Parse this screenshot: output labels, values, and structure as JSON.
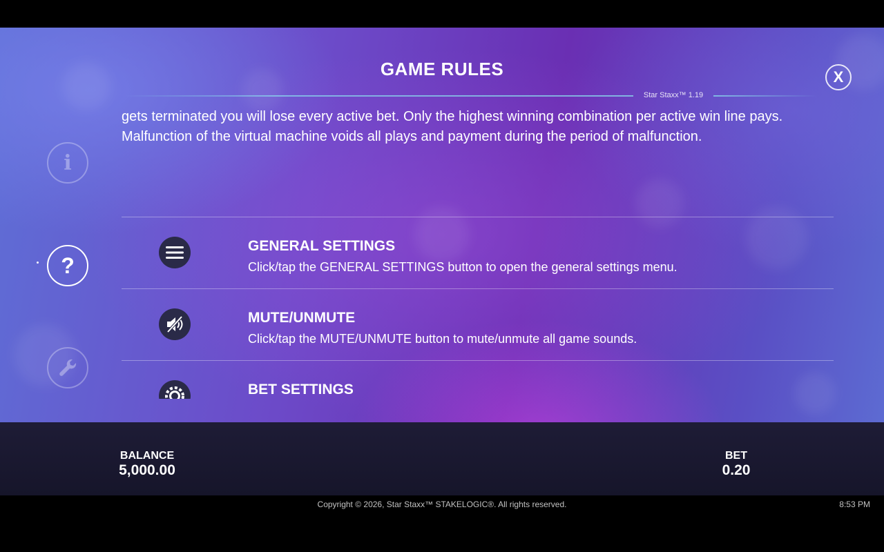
{
  "header": {
    "title": "GAME RULES",
    "version": "Star Staxx™ 1.19",
    "close_label": "X"
  },
  "sidebar": {
    "items": [
      {
        "name": "info",
        "icon": "info-icon",
        "glyph": "i",
        "active": false
      },
      {
        "name": "help",
        "icon": "question-icon",
        "glyph": "?",
        "active": true
      },
      {
        "name": "settings",
        "icon": "wrench-icon",
        "active": false
      }
    ]
  },
  "rules": {
    "intro_text": "gets terminated you will lose every active bet. Only the highest winning combination per active win line pays. Malfunction of the virtual machine voids all plays and payment during the period of malfunction.",
    "items": [
      {
        "icon": "hamburger-menu-icon",
        "title": "GENERAL SETTINGS",
        "description": "Click/tap the GENERAL SETTINGS button to open the general settings menu."
      },
      {
        "icon": "speaker-mute-icon",
        "title": "MUTE/UNMUTE",
        "description": "Click/tap the MUTE/UNMUTE button to mute/unmute all game sounds."
      },
      {
        "icon": "bet-gear-icon",
        "title": "BET SETTINGS",
        "description": ""
      }
    ]
  },
  "status_bar": {
    "balance_label": "BALANCE",
    "balance_value": "5,000.00",
    "bet_label": "BET",
    "bet_value": "0.20"
  },
  "footer": {
    "copyright": "Copyright © 2026, Star Staxx™ STAKELOGIC®. All rights reserved.",
    "time": "8:53 PM"
  },
  "colors": {
    "bottom_bar": "#1e1c36",
    "icon_circle": "#2a2a48",
    "accent_line": "#8ce6f0"
  }
}
